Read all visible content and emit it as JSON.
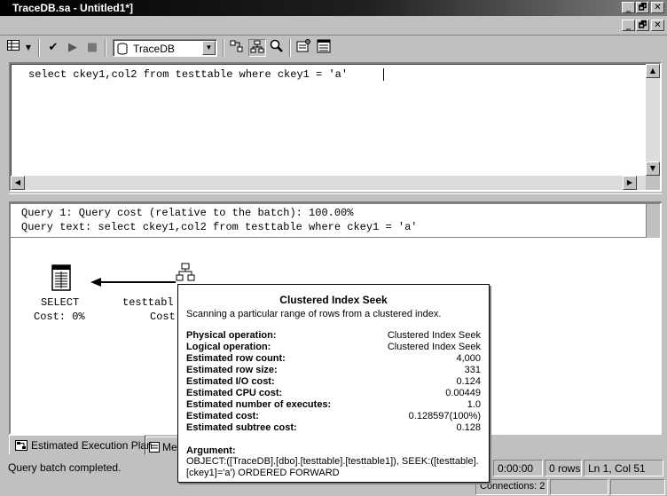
{
  "window": {
    "title": "TraceDB.sa - Untitled1*]"
  },
  "title_buttons": {
    "minimize": "_",
    "restore": "🗗",
    "close": "✕"
  },
  "toolbar": {
    "database": "TraceDB"
  },
  "editor": {
    "query": "select ckey1,col2 from testtable where ckey1 = 'a'"
  },
  "plan": {
    "header_line1": "Query 1: Query cost (relative to the batch): 100.00%",
    "header_line2": "Query text: select ckey1,col2 from testtable where ckey1 = 'a'",
    "select_node": {
      "label": "SELECT",
      "cost": "Cost: 0%"
    },
    "seek_node": {
      "label": "testtabl",
      "cost": "Cost"
    }
  },
  "tooltip": {
    "title": "Clustered Index Seek",
    "description": "Scanning a particular range of rows from a clustered index.",
    "rows": [
      {
        "k": "Physical operation:",
        "v": "Clustered Index Seek"
      },
      {
        "k": "Logical operation:",
        "v": "Clustered Index Seek"
      },
      {
        "k": "Estimated row count:",
        "v": "4,000"
      },
      {
        "k": "Estimated row size:",
        "v": "331"
      },
      {
        "k": "Estimated I/O cost:",
        "v": "0.124"
      },
      {
        "k": "Estimated CPU cost:",
        "v": "0.00449"
      },
      {
        "k": "Estimated number of executes:",
        "v": "1.0"
      },
      {
        "k": "Estimated cost:",
        "v": "0.128597(100%)"
      },
      {
        "k": "Estimated subtree cost:",
        "v": "0.128"
      }
    ],
    "argument_label": "Argument:",
    "argument_text": "OBJECT:([TraceDB].[dbo].[testtable].[testtable1]), SEEK:([testtable].[ckey1]='a') ORDERED FORWARD"
  },
  "tabs": [
    {
      "label": "Estimated Execution Plan"
    },
    {
      "label": "Me"
    }
  ],
  "status": {
    "message": "Query batch completed.",
    "elapsed": "0:00:00",
    "rows": "0 rows",
    "position": "Ln 1, Col 51",
    "connections": "Connections: 2"
  }
}
